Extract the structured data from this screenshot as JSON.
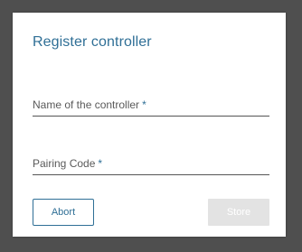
{
  "dialog": {
    "title": "Register controller",
    "fields": {
      "name": {
        "label": "Name of the controller",
        "required_marker": "*",
        "value": ""
      },
      "pairing_code": {
        "label": "Pairing Code",
        "required_marker": "*",
        "value": ""
      }
    },
    "buttons": {
      "abort": "Abort",
      "store": "Store"
    }
  },
  "colors": {
    "accent": "#2f6f96",
    "backdrop": "#4f4f4f",
    "disabled_button": "#e3e3e3"
  }
}
